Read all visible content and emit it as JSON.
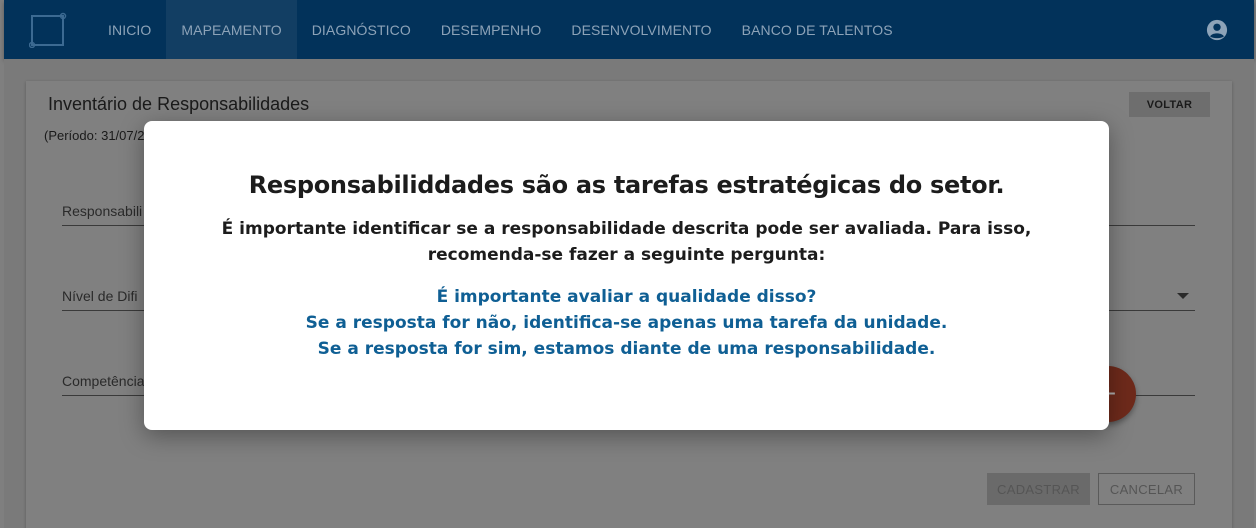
{
  "nav": {
    "items": [
      {
        "label": "INICIO"
      },
      {
        "label": "MAPEAMENTO"
      },
      {
        "label": "DIAGNÓSTICO"
      },
      {
        "label": "DESEMPENHO"
      },
      {
        "label": "DESENVOLVIMENTO"
      },
      {
        "label": "BANCO DE TALENTOS"
      }
    ],
    "active_index": 1,
    "logo_icon": "logo-icon",
    "user_icon": "account-circle-icon"
  },
  "page": {
    "title": "Inventário de Responsabilidades",
    "back_label": "VOLTAR",
    "period_text": "(Período: 31/07/2",
    "fields": [
      {
        "label": "Responsabili"
      },
      {
        "label": "Nível de Difi"
      },
      {
        "label": "Competência"
      }
    ],
    "fab_symbol": "+",
    "submit_label": "CADASTRAR",
    "cancel_label": "CANCELAR"
  },
  "modal": {
    "title": "Responsabiliddades são as tarefas estratégicas do setor.",
    "body_lines": [
      "É importante identificar se a responsabilidade descrita pode ser avaliada. Para isso,",
      "recomenda-se fazer a seguinte pergunta:"
    ],
    "question_lines": [
      "É importante avaliar a qualidade disso?",
      "Se a resposta for não, identifica-se apenas uma tarefa da unidade.",
      "Se a resposta for sim, estamos diante de uma responsabilidade."
    ]
  },
  "colors": {
    "navbar": "#02325a",
    "accent_blue": "#0f5f94",
    "fab_red": "#c0392b"
  }
}
